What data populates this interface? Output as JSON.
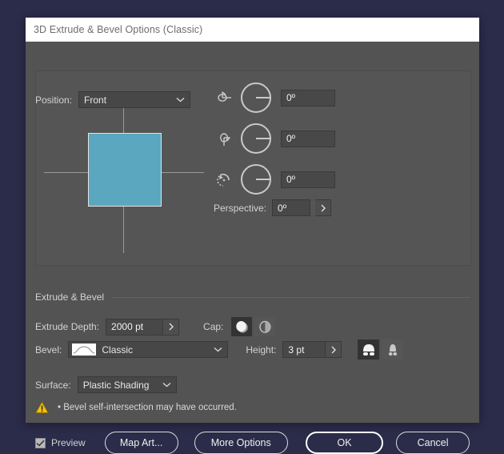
{
  "dialog": {
    "title": "3D Extrude & Bevel Options (Classic)"
  },
  "position": {
    "label": "Position:",
    "value": "Front",
    "chevron_icon": "chevron-down-icon"
  },
  "rotation": {
    "rows": [
      {
        "axis": "x",
        "icon": "rotate-x-axis-icon",
        "value": "0º"
      },
      {
        "axis": "y",
        "icon": "rotate-y-axis-icon",
        "value": "0º"
      },
      {
        "axis": "z",
        "icon": "rotate-z-axis-icon",
        "value": "0º"
      }
    ]
  },
  "perspective": {
    "label": "Perspective:",
    "value": "0º",
    "stepper_icon": "chevron-right-icon"
  },
  "extrude_section": {
    "header": "Extrude & Bevel",
    "depth_label": "Extrude Depth:",
    "depth_value": "2000 pt",
    "depth_stepper_icon": "chevron-right-icon",
    "cap_label": "Cap:",
    "cap_solid_icon": "cap-solid-icon",
    "cap_hollow_icon": "cap-hollow-icon",
    "bevel_label": "Bevel:",
    "bevel_value": "Classic",
    "bevel_swatch_icon": "bevel-classic-swatch-icon",
    "bevel_chevron_icon": "chevron-down-icon",
    "height_label": "Height:",
    "height_value": "3 pt",
    "height_stepper_icon": "chevron-right-icon",
    "bevel_out_icon": "bevel-extent-out-icon",
    "bevel_in_icon": "bevel-extent-in-icon"
  },
  "surface": {
    "label": "Surface:",
    "value": "Plastic Shading",
    "chevron_icon": "chevron-down-icon"
  },
  "warning": {
    "icon": "warning-triangle-icon",
    "text": "• Bevel self-intersection may have occurred."
  },
  "footer": {
    "preview_label": "Preview",
    "preview_checked": true,
    "check_icon": "checkmark-icon",
    "map_art_label": "Map Art...",
    "more_options_label": "More Options",
    "ok_label": "OK",
    "cancel_label": "Cancel"
  },
  "colors": {
    "page_background": "#2b2b4a",
    "dialog_background": "#535353",
    "titlebar_background": "#ffffff",
    "cube_fill": "#5ba7c0",
    "warning_yellow": "#f2c317",
    "text": "#d2d2d2"
  }
}
